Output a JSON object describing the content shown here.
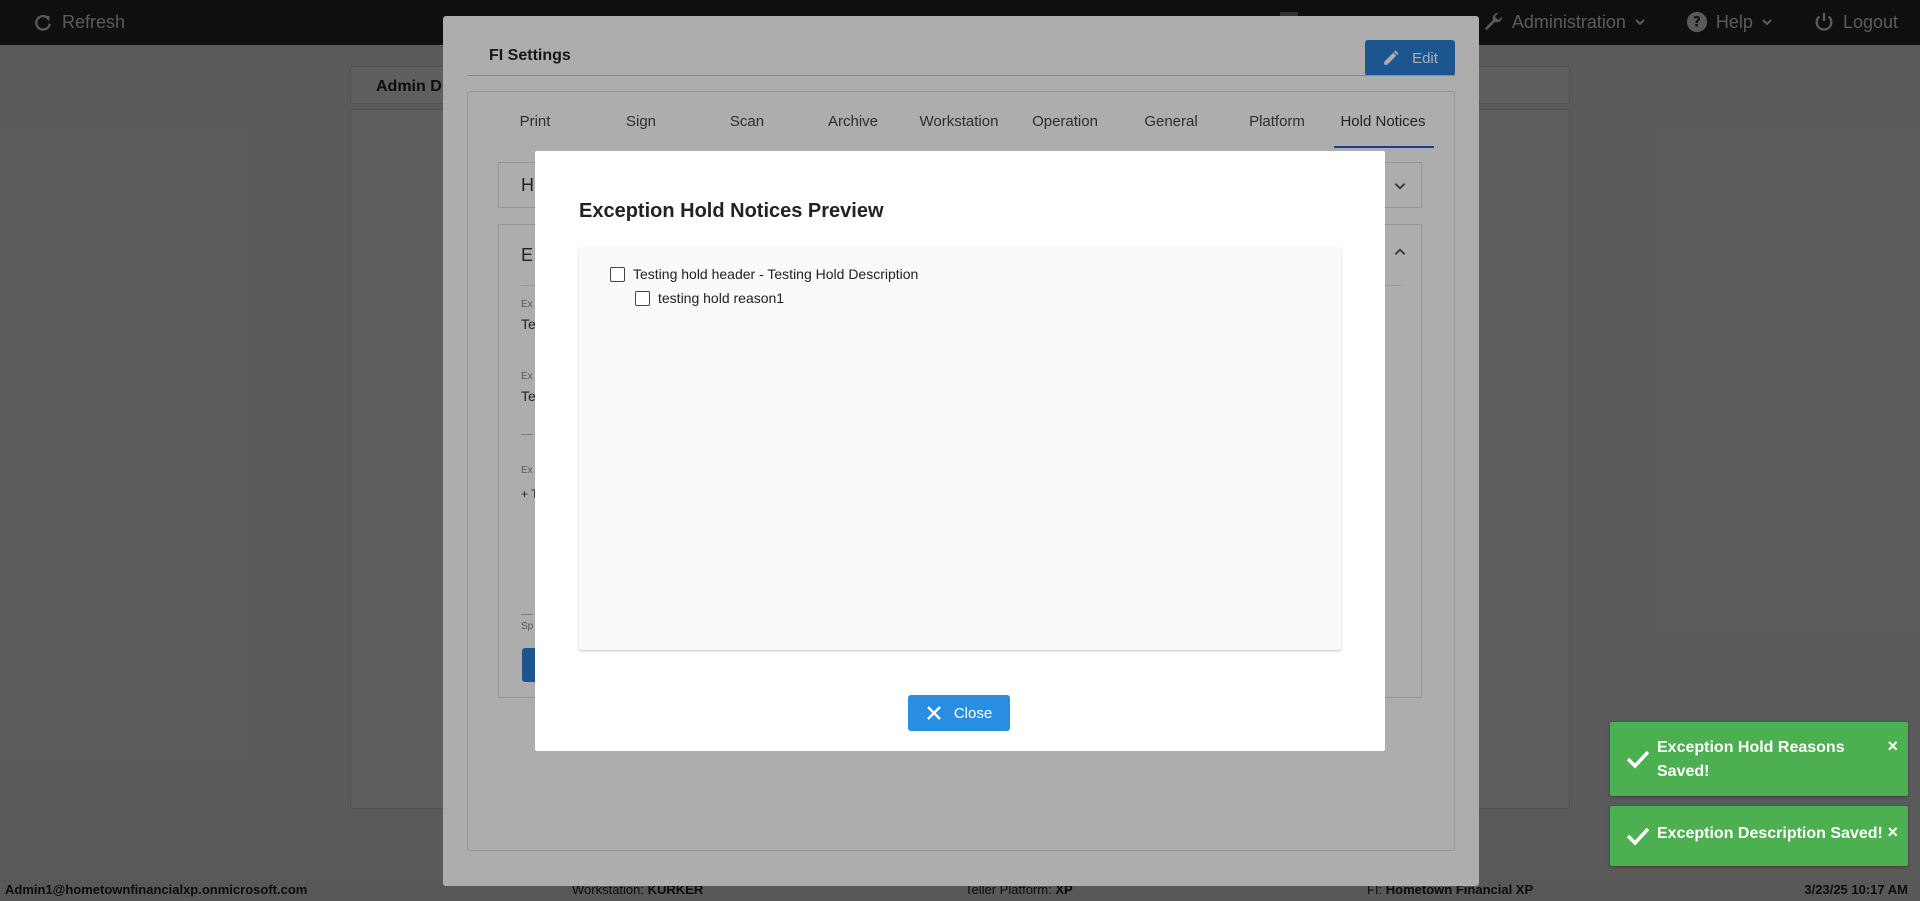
{
  "topbar": {
    "refresh_label": "Refresh",
    "administration_label": "Administration",
    "help_label": "Help",
    "logout_label": "Logout"
  },
  "background": {
    "admin_title": "Admin D"
  },
  "fi_settings": {
    "title": "FI Settings",
    "edit_label": "Edit",
    "tabs": [
      "Print",
      "Sign",
      "Scan",
      "Archive",
      "Workstation",
      "Operation",
      "General",
      "Platform",
      "Hold Notices"
    ],
    "active_tab": "Hold Notices",
    "partial": {
      "acc1_letter": "H",
      "acc2_letter": "E",
      "label1": "Ex",
      "value1": "Te",
      "label2": "Ex",
      "value2": "Te",
      "label3": "Ex",
      "value3": "+ T",
      "label4": "Sp"
    }
  },
  "preview_modal": {
    "title": "Exception Hold Notices Preview",
    "items": [
      {
        "label": "Testing hold header - Testing Hold Description",
        "level": 0,
        "checked": false
      },
      {
        "label": "testing hold reason1",
        "level": 1,
        "checked": false
      }
    ],
    "close_label": "Close"
  },
  "toasts": [
    {
      "message": "Exception Hold Reasons Saved!"
    },
    {
      "message": "Exception Description Saved!"
    }
  ],
  "statusbar": {
    "user": "Admin1@hometownfinancialxp.onmicrosoft.com",
    "workstation_label": "Workstation:",
    "workstation_value": "KURKER",
    "platform_label": "Teller Platform:",
    "platform_value": "XP",
    "fi_label": "FI:",
    "fi_value": "Hometown Financial XP",
    "datetime": "3/23/25 10:17 AM"
  },
  "colors": {
    "topbar": "#2a2a2a",
    "primary_button": "#2a7fd4",
    "toast_success": "#4caf50",
    "tab_underline": "#2a5bd4"
  }
}
